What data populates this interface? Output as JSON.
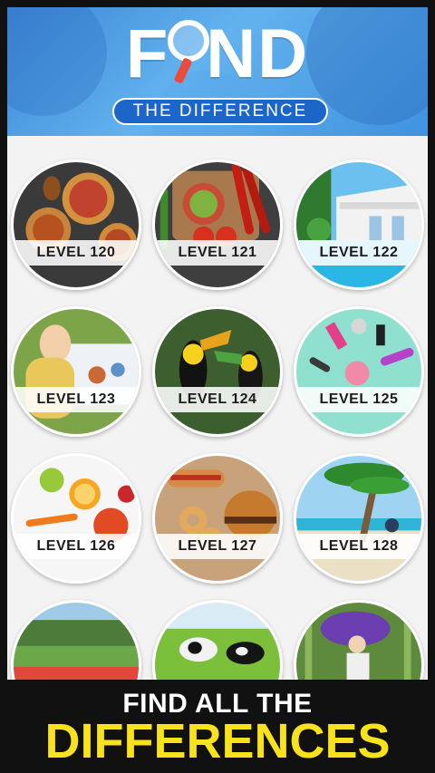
{
  "header": {
    "title_f": "F",
    "title_rest": "ND",
    "subtitle": "THE DIFFERENCE"
  },
  "levels": [
    {
      "label": "LEVEL 120",
      "theme": "pies-food"
    },
    {
      "label": "LEVEL 121",
      "theme": "vegetables"
    },
    {
      "label": "LEVEL 122",
      "theme": "villa-pool"
    },
    {
      "label": "LEVEL 123",
      "theme": "picnic"
    },
    {
      "label": "LEVEL 124",
      "theme": "toucans"
    },
    {
      "label": "LEVEL 125",
      "theme": "cosmetics"
    },
    {
      "label": "LEVEL 126",
      "theme": "fruits"
    },
    {
      "label": "LEVEL 127",
      "theme": "fast-food"
    },
    {
      "label": "LEVEL 128",
      "theme": "beach-palm"
    },
    {
      "label": "",
      "theme": "flower-garden"
    },
    {
      "label": "",
      "theme": "cows-field"
    },
    {
      "label": "",
      "theme": "bamboo-umbrella"
    }
  ],
  "banner": {
    "line1": "FIND ALL THE",
    "line2": "DIFFERENCES"
  },
  "colors": {
    "header_blue": "#3c86d6",
    "subtitle_pill": "#1d66c9",
    "banner_yellow": "#f7e21b",
    "magnifier_handle": "#e74c3c"
  }
}
